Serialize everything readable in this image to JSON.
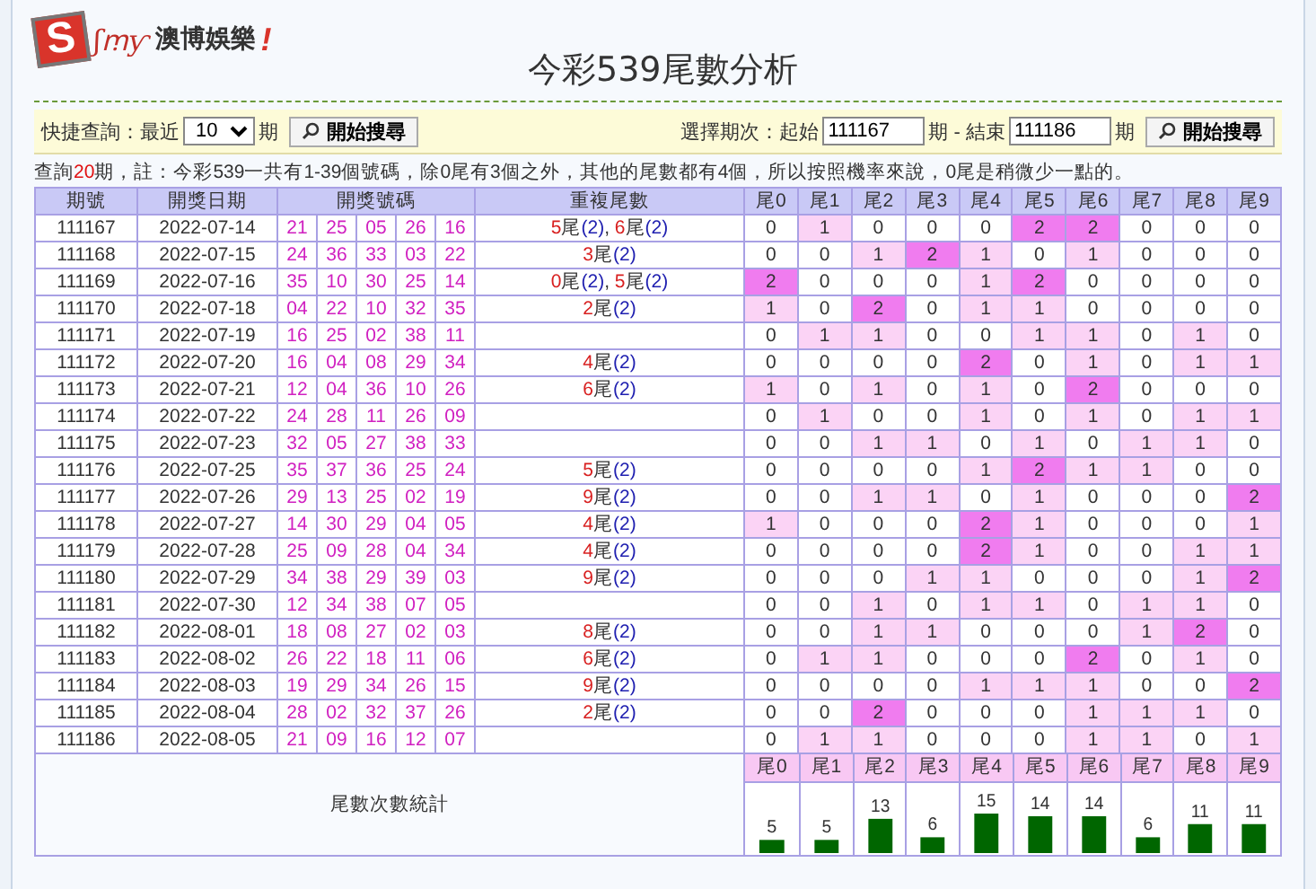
{
  "logo": {
    "letter": "S",
    "script": "ʃꭑƴ",
    "name": "澳博娛樂",
    "mark": "!"
  },
  "title": "今彩539尾數分析",
  "quick": {
    "label": "快捷查詢：最近",
    "value": "10",
    "unit": "期",
    "button": "開始搜尋"
  },
  "range": {
    "label": "選擇期次：起始",
    "start": "111167",
    "middle": "期 - 結束",
    "end": "111186",
    "unit": "期",
    "button": "開始搜尋"
  },
  "note": {
    "prefix": "查詢",
    "count": "20",
    "text": "期，註：今彩539一共有1-39個號碼，除0尾有3個之外，其他的尾數都有4個，所以按照機率來說，0尾是稍微少一點的。"
  },
  "table": {
    "columns": [
      "期號",
      "開獎日期",
      "開獎號碼",
      "重複尾數",
      "尾0",
      "尾1",
      "尾2",
      "尾3",
      "尾4",
      "尾5",
      "尾6",
      "尾7",
      "尾8",
      "尾9"
    ],
    "rows": [
      {
        "period": "111167",
        "date": "2022-07-14",
        "numbers": [
          "21",
          "25",
          "05",
          "26",
          "16"
        ],
        "repeats": [
          {
            "digit": "5",
            "unit": "尾",
            "count": "(2)"
          },
          {
            "sep": ", ",
            "digit": "6",
            "unit": "尾",
            "count": "(2)"
          }
        ],
        "tails": [
          "0",
          "1",
          "0",
          "0",
          "0",
          "2",
          "2",
          "0",
          "0",
          "0"
        ]
      },
      {
        "period": "111168",
        "date": "2022-07-15",
        "numbers": [
          "24",
          "36",
          "33",
          "03",
          "22"
        ],
        "repeats": [
          {
            "digit": "3",
            "unit": "尾",
            "count": "(2)"
          }
        ],
        "tails": [
          "0",
          "0",
          "1",
          "2",
          "1",
          "0",
          "1",
          "0",
          "0",
          "0"
        ]
      },
      {
        "period": "111169",
        "date": "2022-07-16",
        "numbers": [
          "35",
          "10",
          "30",
          "25",
          "14"
        ],
        "repeats": [
          {
            "digit": "0",
            "unit": "尾",
            "count": "(2)"
          },
          {
            "sep": ", ",
            "digit": "5",
            "unit": "尾",
            "count": "(2)"
          }
        ],
        "tails": [
          "2",
          "0",
          "0",
          "0",
          "1",
          "2",
          "0",
          "0",
          "0",
          "0"
        ]
      },
      {
        "period": "111170",
        "date": "2022-07-18",
        "numbers": [
          "04",
          "22",
          "10",
          "32",
          "35"
        ],
        "repeats": [
          {
            "digit": "2",
            "unit": "尾",
            "count": "(2)"
          }
        ],
        "tails": [
          "1",
          "0",
          "2",
          "0",
          "1",
          "1",
          "0",
          "0",
          "0",
          "0"
        ]
      },
      {
        "period": "111171",
        "date": "2022-07-19",
        "numbers": [
          "16",
          "25",
          "02",
          "38",
          "11"
        ],
        "repeats": [],
        "tails": [
          "0",
          "1",
          "1",
          "0",
          "0",
          "1",
          "1",
          "0",
          "1",
          "0"
        ]
      },
      {
        "period": "111172",
        "date": "2022-07-20",
        "numbers": [
          "16",
          "04",
          "08",
          "29",
          "34"
        ],
        "repeats": [
          {
            "digit": "4",
            "unit": "尾",
            "count": "(2)"
          }
        ],
        "tails": [
          "0",
          "0",
          "0",
          "0",
          "2",
          "0",
          "1",
          "0",
          "1",
          "1"
        ]
      },
      {
        "period": "111173",
        "date": "2022-07-21",
        "numbers": [
          "12",
          "04",
          "36",
          "10",
          "26"
        ],
        "repeats": [
          {
            "digit": "6",
            "unit": "尾",
            "count": "(2)"
          }
        ],
        "tails": [
          "1",
          "0",
          "1",
          "0",
          "1",
          "0",
          "2",
          "0",
          "0",
          "0"
        ]
      },
      {
        "period": "111174",
        "date": "2022-07-22",
        "numbers": [
          "24",
          "28",
          "11",
          "26",
          "09"
        ],
        "repeats": [],
        "tails": [
          "0",
          "1",
          "0",
          "0",
          "1",
          "0",
          "1",
          "0",
          "1",
          "1"
        ]
      },
      {
        "period": "111175",
        "date": "2022-07-23",
        "numbers": [
          "32",
          "05",
          "27",
          "38",
          "33"
        ],
        "repeats": [],
        "tails": [
          "0",
          "0",
          "1",
          "1",
          "0",
          "1",
          "0",
          "1",
          "1",
          "0"
        ]
      },
      {
        "period": "111176",
        "date": "2022-07-25",
        "numbers": [
          "35",
          "37",
          "36",
          "25",
          "24"
        ],
        "repeats": [
          {
            "digit": "5",
            "unit": "尾",
            "count": "(2)"
          }
        ],
        "tails": [
          "0",
          "0",
          "0",
          "0",
          "1",
          "2",
          "1",
          "1",
          "0",
          "0"
        ]
      },
      {
        "period": "111177",
        "date": "2022-07-26",
        "numbers": [
          "29",
          "13",
          "25",
          "02",
          "19"
        ],
        "repeats": [
          {
            "digit": "9",
            "unit": "尾",
            "count": "(2)"
          }
        ],
        "tails": [
          "0",
          "0",
          "1",
          "1",
          "0",
          "1",
          "0",
          "0",
          "0",
          "2"
        ]
      },
      {
        "period": "111178",
        "date": "2022-07-27",
        "numbers": [
          "14",
          "30",
          "29",
          "04",
          "05"
        ],
        "repeats": [
          {
            "digit": "4",
            "unit": "尾",
            "count": "(2)"
          }
        ],
        "tails": [
          "1",
          "0",
          "0",
          "0",
          "2",
          "1",
          "0",
          "0",
          "0",
          "1"
        ]
      },
      {
        "period": "111179",
        "date": "2022-07-28",
        "numbers": [
          "25",
          "09",
          "28",
          "04",
          "34"
        ],
        "repeats": [
          {
            "digit": "4",
            "unit": "尾",
            "count": "(2)"
          }
        ],
        "tails": [
          "0",
          "0",
          "0",
          "0",
          "2",
          "1",
          "0",
          "0",
          "1",
          "1"
        ]
      },
      {
        "period": "111180",
        "date": "2022-07-29",
        "numbers": [
          "34",
          "38",
          "29",
          "39",
          "03"
        ],
        "repeats": [
          {
            "digit": "9",
            "unit": "尾",
            "count": "(2)"
          }
        ],
        "tails": [
          "0",
          "0",
          "0",
          "1",
          "1",
          "0",
          "0",
          "0",
          "1",
          "2"
        ]
      },
      {
        "period": "111181",
        "date": "2022-07-30",
        "numbers": [
          "12",
          "34",
          "38",
          "07",
          "05"
        ],
        "repeats": [],
        "tails": [
          "0",
          "0",
          "1",
          "0",
          "1",
          "1",
          "0",
          "1",
          "1",
          "0"
        ]
      },
      {
        "period": "111182",
        "date": "2022-08-01",
        "numbers": [
          "18",
          "08",
          "27",
          "02",
          "03"
        ],
        "repeats": [
          {
            "digit": "8",
            "unit": "尾",
            "count": "(2)"
          }
        ],
        "tails": [
          "0",
          "0",
          "1",
          "1",
          "0",
          "0",
          "0",
          "1",
          "2",
          "0"
        ]
      },
      {
        "period": "111183",
        "date": "2022-08-02",
        "numbers": [
          "26",
          "22",
          "18",
          "11",
          "06"
        ],
        "repeats": [
          {
            "digit": "6",
            "unit": "尾",
            "count": "(2)"
          }
        ],
        "tails": [
          "0",
          "1",
          "1",
          "0",
          "0",
          "0",
          "2",
          "0",
          "1",
          "0"
        ]
      },
      {
        "period": "111184",
        "date": "2022-08-03",
        "numbers": [
          "19",
          "29",
          "34",
          "26",
          "15"
        ],
        "repeats": [
          {
            "digit": "9",
            "unit": "尾",
            "count": "(2)"
          }
        ],
        "tails": [
          "0",
          "0",
          "0",
          "0",
          "1",
          "1",
          "1",
          "0",
          "0",
          "2"
        ]
      },
      {
        "period": "111185",
        "date": "2022-08-04",
        "numbers": [
          "28",
          "02",
          "32",
          "37",
          "26"
        ],
        "repeats": [
          {
            "digit": "2",
            "unit": "尾",
            "count": "(2)"
          }
        ],
        "tails": [
          "0",
          "0",
          "2",
          "0",
          "0",
          "0",
          "1",
          "1",
          "1",
          "0"
        ]
      },
      {
        "period": "111186",
        "date": "2022-08-05",
        "numbers": [
          "21",
          "09",
          "16",
          "12",
          "07"
        ],
        "repeats": [],
        "tails": [
          "0",
          "1",
          "1",
          "0",
          "0",
          "0",
          "1",
          "1",
          "0",
          "1"
        ]
      }
    ],
    "summary": {
      "label": "尾數次數統計",
      "chart_data": {
        "type": "bar",
        "categories": [
          "尾0",
          "尾1",
          "尾2",
          "尾3",
          "尾4",
          "尾5",
          "尾6",
          "尾7",
          "尾8",
          "尾9"
        ],
        "series": [
          {
            "color": "#006600",
            "values": [
              5,
              5,
              13,
              6,
              15,
              14,
              14,
              6,
              11,
              11
            ]
          }
        ],
        "data_labels": true
      }
    }
  }
}
